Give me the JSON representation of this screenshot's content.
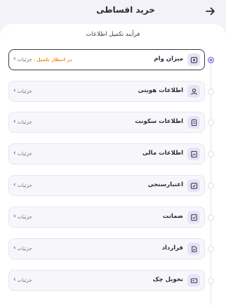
{
  "header": {
    "title": "خرید اقساطی"
  },
  "main": {
    "subtitle": "فرآیند تکمیل اطلاعات"
  },
  "steps": [
    {
      "label": "میزان وام",
      "status": "در انتظار تکمیل",
      "separator": "-",
      "details": "جزئیات",
      "icon": "loan-icon",
      "active": true
    },
    {
      "label": "اطلاعات هویتی",
      "details": "جزئیات",
      "icon": "user-icon"
    },
    {
      "label": "اطلاعات سکونت",
      "details": "جزئیات",
      "icon": "residence-icon"
    },
    {
      "label": "اطلاعات مالی",
      "details": "جزئیات",
      "icon": "finance-icon"
    },
    {
      "label": "اعتبارسنجی",
      "details": "جزئیات",
      "icon": "credit-check-icon"
    },
    {
      "label": "ضمانت",
      "details": "جزئیات",
      "icon": "guarantee-icon"
    },
    {
      "label": "قرارداد",
      "details": "جزئیات",
      "icon": "contract-icon"
    },
    {
      "label": "تحویل چک",
      "details": "جزئیات",
      "icon": "cheque-icon"
    }
  ],
  "colors": {
    "accent": "#6b5bd6",
    "pending": "#f08a1c",
    "icon_bg": "#e7e3f7"
  }
}
